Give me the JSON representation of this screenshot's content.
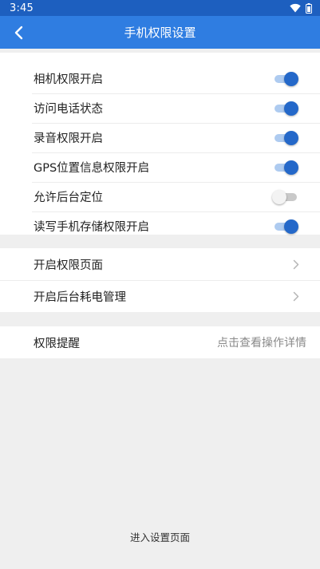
{
  "status_bar": {
    "time": "3:45",
    "icons": [
      "wifi-icon",
      "battery-icon"
    ]
  },
  "app_bar": {
    "title": "手机权限设置",
    "back_icon": "chevron-left-icon"
  },
  "permissions": [
    {
      "label": "相机权限开启",
      "enabled": true
    },
    {
      "label": "访问电话状态",
      "enabled": true
    },
    {
      "label": "录音权限开启",
      "enabled": true
    },
    {
      "label": "GPS位置信息权限开启",
      "enabled": true
    },
    {
      "label": "允许后台定位",
      "enabled": false
    },
    {
      "label": "读写手机存储权限开启",
      "enabled": true
    }
  ],
  "navigation": [
    {
      "label": "开启权限页面",
      "icon": "chevron-right-icon"
    },
    {
      "label": "开启后台耗电管理",
      "icon": "chevron-right-icon"
    }
  ],
  "reminder": {
    "label": "权限提醒",
    "hint": "点击查看操作详情"
  },
  "footer": {
    "link_label": "进入设置页面"
  },
  "colors": {
    "status_bar": "#1d5fbf",
    "app_bar": "#2f7de1",
    "switch_on_thumb": "#2468c9",
    "switch_on_track": "#aecbf0",
    "background": "#efefef"
  }
}
